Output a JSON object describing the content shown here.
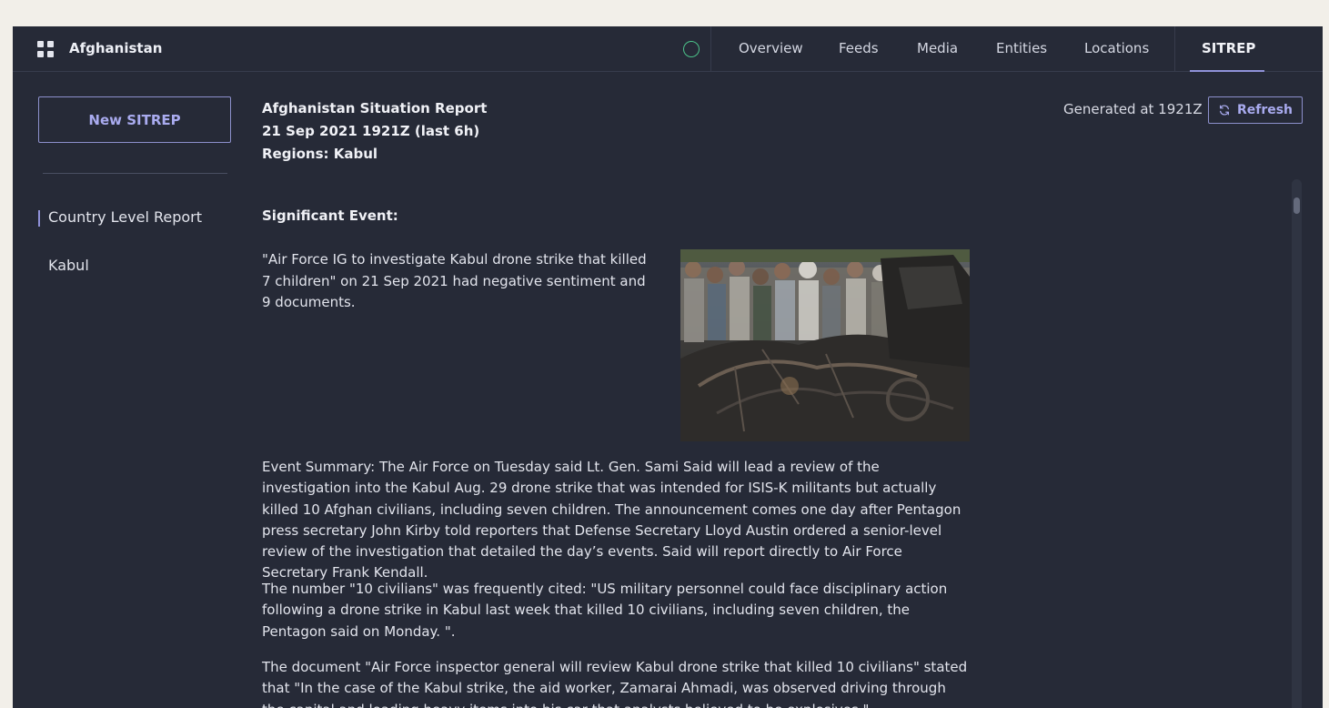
{
  "header": {
    "title": "Afghanistan",
    "tabs": [
      {
        "label": "Overview",
        "active": false
      },
      {
        "label": "Feeds",
        "active": false
      },
      {
        "label": "Media",
        "active": false
      },
      {
        "label": "Entities",
        "active": false
      },
      {
        "label": "Locations",
        "active": false
      },
      {
        "label": "SITREP",
        "active": true
      }
    ],
    "status_color": "#4cc38a"
  },
  "sidebar": {
    "new_button": "New SITREP",
    "items": [
      {
        "label": "Country Level Report",
        "active": true
      },
      {
        "label": "Kabul",
        "active": false
      }
    ]
  },
  "report": {
    "title": "Afghanistan Situation Report",
    "date_range": "21 Sep 2021 1921Z (last 6h)",
    "regions": "Regions: Kabul",
    "generated": "Generated at 1921Z",
    "refresh_label": "Refresh",
    "significant_event_label": "Significant Event:",
    "lede": "\"Air Force IG to investigate Kabul drone strike that killed 7 children\" on 21 Sep 2021 had negative sentiment and 9 documents.",
    "summary": "Event Summary: The Air Force on Tuesday said Lt. Gen. Sami Said will lead a review of the investigation into the Kabul Aug. 29 drone strike that was intended for ISIS-K militants but actually killed 10 Afghan civilians, including seven children. The announcement comes one day after Pentagon press secretary John Kirby told reporters that Defense Secretary Lloyd Austin ordered a senior-level review of the investigation that detailed the day’s events. Said will report directly to Air Force Secretary Frank Kendall.",
    "cited": "The number \"10 civilians\" was frequently cited: \"US military personnel could face disciplinary action following a drone strike in Kabul last week that killed 10 civilians, including seven children, the Pentagon said on Monday. \".",
    "document": "The document \"Air Force inspector general will review Kabul drone strike that killed 10 civilians\" stated that \"In the case of the Kabul strike, the aid worker, Zamarai Ahmadi, was observed driving through the capital and loading heavy items into his car that analysts believed to be explosives.\""
  },
  "accent_color": "#8f91d8"
}
